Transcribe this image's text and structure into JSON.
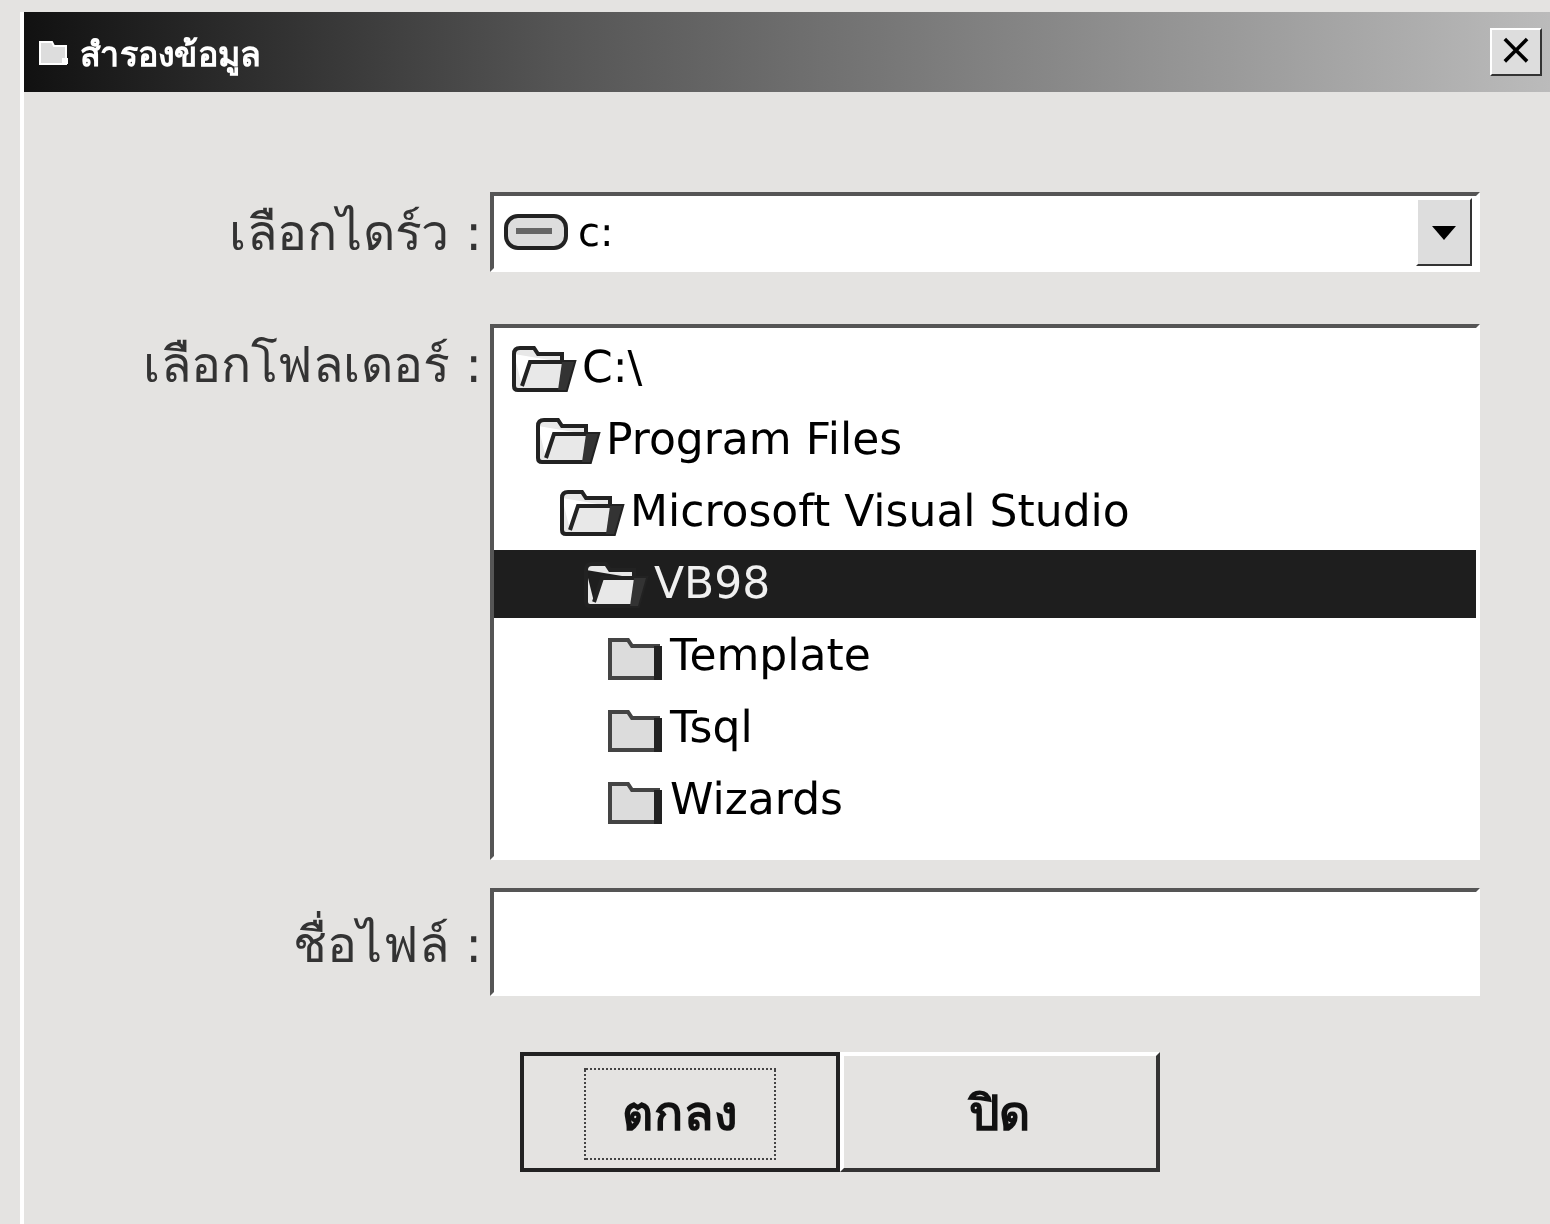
{
  "window": {
    "title": "สำรองข้อมูล",
    "close_label": "×"
  },
  "drive": {
    "label": "เลือกไดร์ว :",
    "value": "c:"
  },
  "folders": {
    "label": "เลือกโฟลเดอร์ :",
    "tree": [
      {
        "name": "C:\\",
        "expanded": true,
        "selected": false,
        "children": [
          {
            "name": "Program Files",
            "expanded": true,
            "selected": false,
            "children": [
              {
                "name": "Microsoft Visual Studio",
                "expanded": true,
                "selected": false,
                "children": [
                  {
                    "name": "VB98",
                    "expanded": true,
                    "selected": true,
                    "children": [
                      {
                        "name": "Template",
                        "expanded": false,
                        "selected": false
                      },
                      {
                        "name": "Tsql",
                        "expanded": false,
                        "selected": false
                      },
                      {
                        "name": "Wizards",
                        "expanded": false,
                        "selected": false
                      }
                    ]
                  }
                ]
              }
            ]
          }
        ]
      }
    ]
  },
  "filename": {
    "label": "ชื่อไฟล์ :"
  },
  "buttons": [
    {
      "label": "ตกลง",
      "default": true
    },
    {
      "label": "ปิด",
      "default": false
    }
  ]
}
